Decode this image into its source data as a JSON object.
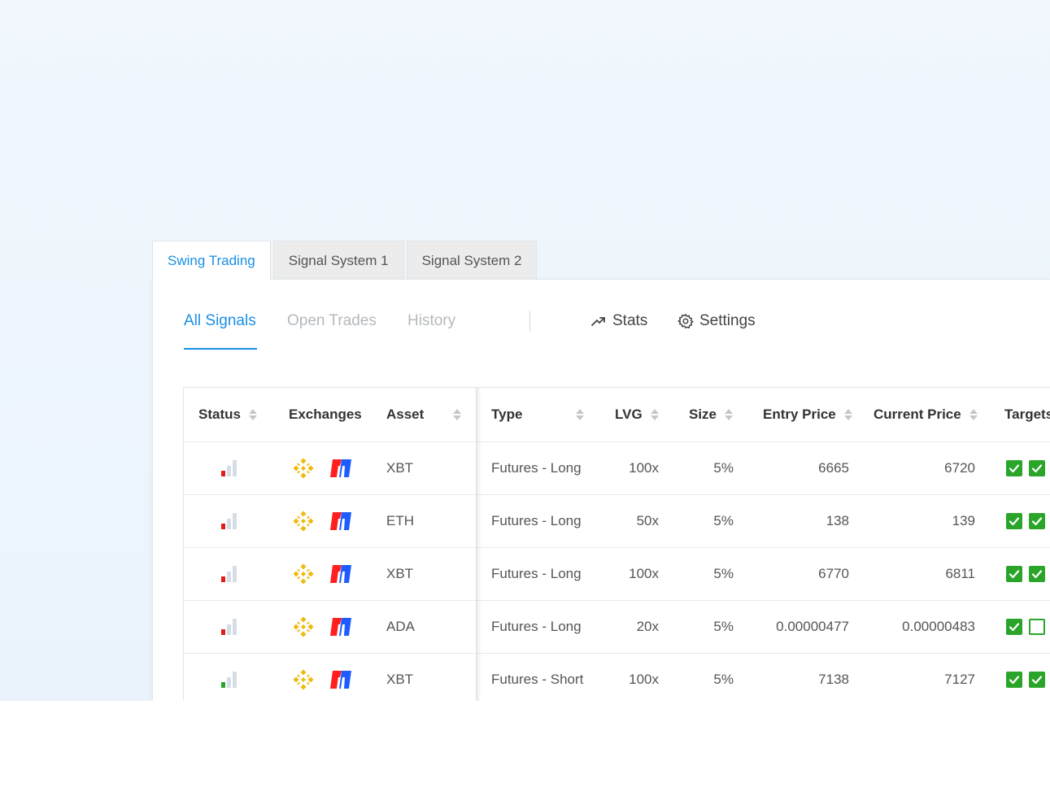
{
  "system_tabs": [
    {
      "label": "Swing Trading",
      "active": true
    },
    {
      "label": "Signal System 1",
      "active": false
    },
    {
      "label": "Signal System 2",
      "active": false
    }
  ],
  "subnav": {
    "tabs": [
      {
        "label": "All Signals",
        "active": true
      },
      {
        "label": "Open Trades",
        "active": false
      },
      {
        "label": "History",
        "active": false
      }
    ],
    "stats_label": "Stats",
    "settings_label": "Settings"
  },
  "colors": {
    "accent": "#1a8fe3",
    "status_red": "#e01e1e",
    "status_green": "#2aa52a",
    "binance": "#f0b90b",
    "bitmex_red": "#ff1f1f",
    "bitmex_blue": "#1e5cff"
  },
  "table": {
    "columns": {
      "status": "Status",
      "exchanges": "Exchanges",
      "asset": "Asset",
      "type": "Type",
      "lvg": "LVG",
      "size": "Size",
      "entry_price": "Entry Price",
      "current_price": "Current Price",
      "targets": "Targets"
    },
    "rows": [
      {
        "status": "red",
        "exchanges": [
          "binance-icon",
          "bitmex-icon"
        ],
        "asset": "XBT",
        "type": "Futures - Long",
        "lvg": "100x",
        "size": "5%",
        "entry_price": "6665",
        "current_price": "6720",
        "targets": [
          true,
          true
        ]
      },
      {
        "status": "red",
        "exchanges": [
          "binance-icon",
          "bitmex-icon"
        ],
        "asset": "ETH",
        "type": "Futures - Long",
        "lvg": "50x",
        "size": "5%",
        "entry_price": "138",
        "current_price": "139",
        "targets": [
          true,
          true
        ]
      },
      {
        "status": "red",
        "exchanges": [
          "binance-icon",
          "bitmex-icon"
        ],
        "asset": "XBT",
        "type": "Futures - Long",
        "lvg": "100x",
        "size": "5%",
        "entry_price": "6770",
        "current_price": "6811",
        "targets": [
          true,
          true
        ]
      },
      {
        "status": "red",
        "exchanges": [
          "binance-icon",
          "bitmex-icon"
        ],
        "asset": "ADA",
        "type": "Futures - Long",
        "lvg": "20x",
        "size": "5%",
        "entry_price": "0.00000477",
        "current_price": "0.00000483",
        "targets": [
          true,
          false
        ]
      },
      {
        "status": "green",
        "exchanges": [
          "binance-icon",
          "bitmex-icon"
        ],
        "asset": "XBT",
        "type": "Futures - Short",
        "lvg": "100x",
        "size": "5%",
        "entry_price": "7138",
        "current_price": "7127",
        "targets": [
          true,
          true
        ]
      }
    ]
  }
}
